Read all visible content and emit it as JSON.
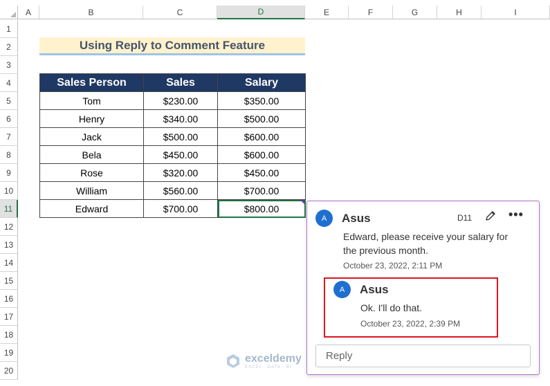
{
  "columns": [
    "A",
    "B",
    "C",
    "D",
    "E",
    "F",
    "G",
    "H",
    "I"
  ],
  "rows": [
    "1",
    "2",
    "3",
    "4",
    "5",
    "6",
    "7",
    "8",
    "9",
    "10",
    "11",
    "12",
    "13",
    "14",
    "15",
    "16",
    "17",
    "18",
    "19",
    "20"
  ],
  "title": "Using Reply to Comment Feature",
  "table": {
    "headers": [
      "Sales Person",
      "Sales",
      "Salary"
    ],
    "rows": [
      [
        "Tom",
        "$230.00",
        "$350.00"
      ],
      [
        "Henry",
        "$340.00",
        "$500.00"
      ],
      [
        "Jack",
        "$500.00",
        "$600.00"
      ],
      [
        "Bela",
        "$450.00",
        "$600.00"
      ],
      [
        "Rose",
        "$320.00",
        "$450.00"
      ],
      [
        "William",
        "$560.00",
        "$700.00"
      ],
      [
        "Edward",
        "$700.00",
        "$800.00"
      ]
    ]
  },
  "comment": {
    "avatar": "A",
    "author": "Asus",
    "cell_ref": "D11",
    "more": "•••",
    "text_line1": "Edward, please receive your salary for",
    "text_line2": "the previous month.",
    "timestamp": "October 23, 2022, 2:11 PM",
    "reply": {
      "avatar": "A",
      "author": "Asus",
      "text": "Ok. I'll do that.",
      "timestamp": "October 23, 2022, 2:39 PM"
    },
    "reply_placeholder": "Reply"
  },
  "watermark": {
    "name": "exceldemy",
    "tagline": "EXCEL · DATA · BI"
  },
  "colors": {
    "header_bg": "#1f3864",
    "title_bg": "#fff2cc",
    "selection": "#217346",
    "comment_border": "#b071c6",
    "highlight_box": "#e0131f",
    "avatar": "#1f6fd1"
  }
}
